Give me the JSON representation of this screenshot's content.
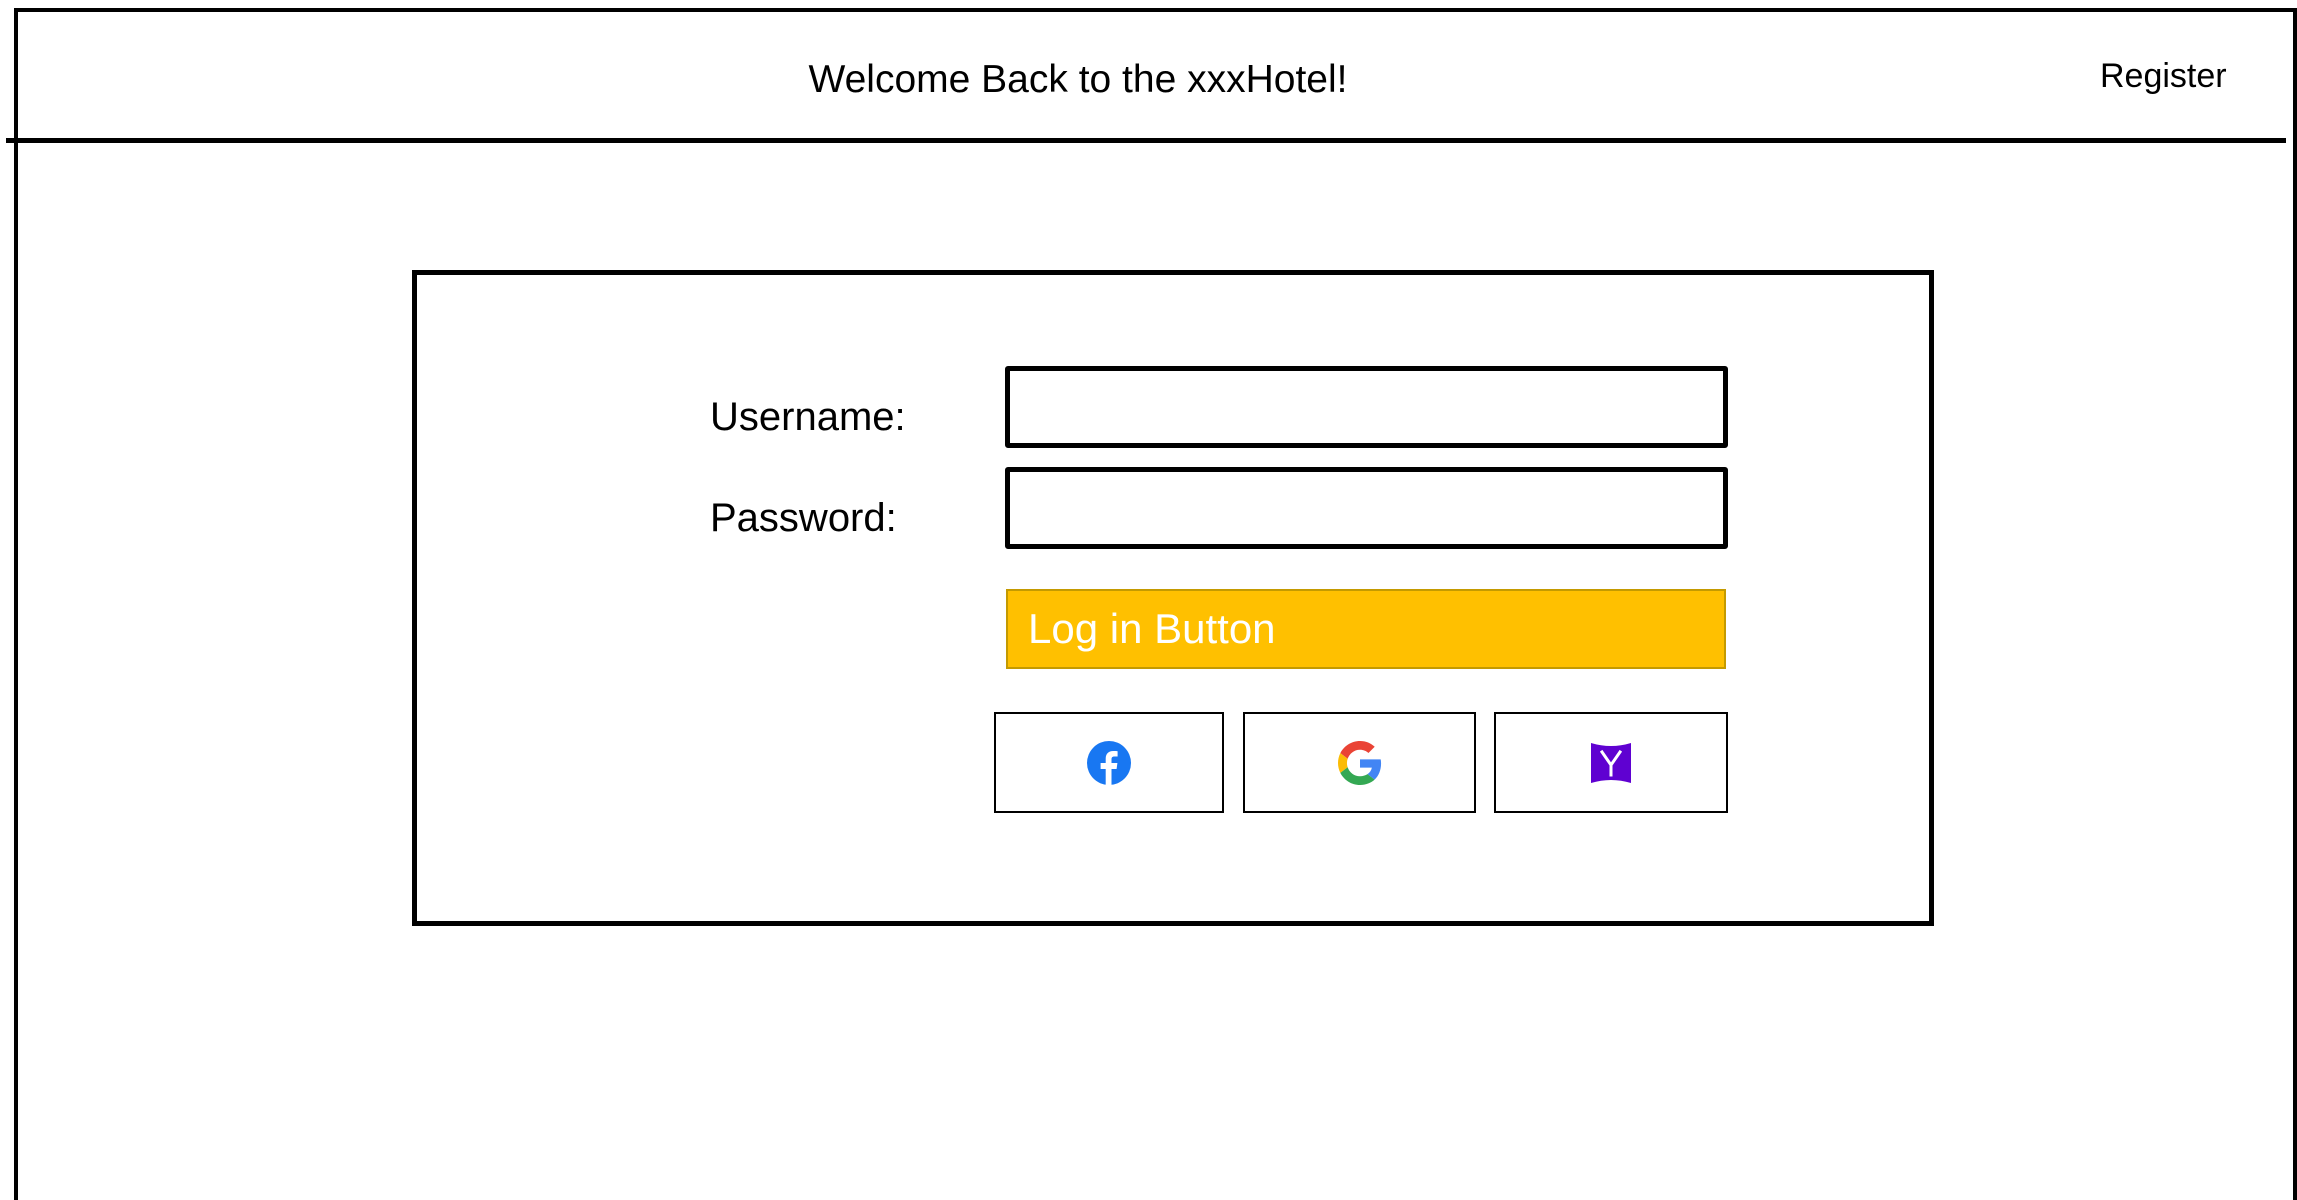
{
  "header": {
    "title": "Welcome Back to the xxxHotel!",
    "register_label": "Register"
  },
  "login_form": {
    "username_label": "Username:",
    "username_value": "",
    "password_label": "Password:",
    "password_value": "",
    "login_button_label": "Log in Button"
  },
  "social_login": [
    {
      "provider": "facebook",
      "icon": "facebook-icon",
      "color": "#1877F2"
    },
    {
      "provider": "google",
      "icon": "google-icon",
      "color": "#4285F4"
    },
    {
      "provider": "yahoo",
      "icon": "yahoo-icon",
      "color": "#5F01D1"
    }
  ],
  "colors": {
    "login_button_bg": "#FFC000",
    "login_button_text": "#FFFFFF"
  }
}
